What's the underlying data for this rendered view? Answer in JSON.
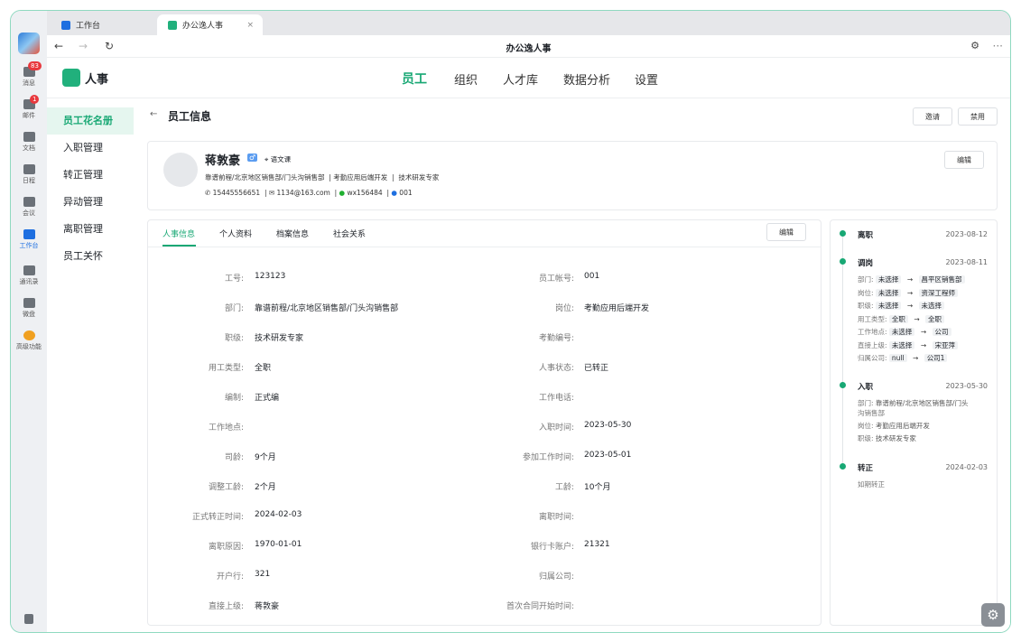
{
  "rail": {
    "badge_messages": "83",
    "badge_mail": "1",
    "items": [
      "消息",
      "邮件",
      "文档",
      "日程",
      "会议",
      "工作台",
      "通讯录",
      "微盘",
      "高级功能"
    ]
  },
  "tabs": [
    "工作台",
    "办公逸人事"
  ],
  "address_title": "办公逸人事",
  "brand": "人事",
  "topnav": [
    "员工",
    "组织",
    "人才库",
    "数据分析",
    "设置"
  ],
  "sidebar": [
    "员工花名册",
    "入职管理",
    "转正管理",
    "异动管理",
    "离职管理",
    "员工关怀"
  ],
  "page_title": "员工信息",
  "buttons": {
    "invite": "邀请",
    "disable": "禁用",
    "edit": "编辑"
  },
  "profile": {
    "name": "蒋敦豪",
    "gender": "♂",
    "tag": "语文课",
    "dept_line": "靠谱前程/北京地区销售部/门头沟销售部",
    "post": "考勤应用后端开发",
    "level": "技术研发专家",
    "phone": "15445556651",
    "email": "1134@163.com",
    "wechat": "wx156484",
    "im": "001"
  },
  "info_tabs": [
    "人事信息",
    "个人资料",
    "档案信息",
    "社会关系"
  ],
  "fields_left": [
    [
      "工号:",
      "123123"
    ],
    [
      "部门:",
      "靠谱前程/北京地区销售部/门头沟销售部"
    ],
    [
      "职级:",
      "技术研发专家"
    ],
    [
      "用工类型:",
      "全职"
    ],
    [
      "编制:",
      "正式编"
    ],
    [
      "工作地点:",
      ""
    ],
    [
      "司龄:",
      "9个月"
    ],
    [
      "调整工龄:",
      "2个月"
    ],
    [
      "正式转正时间:",
      "2024-02-03"
    ],
    [
      "离职原因:",
      "1970-01-01"
    ],
    [
      "开户行:",
      "321"
    ],
    [
      "直接上级:",
      "蒋敦豪"
    ]
  ],
  "fields_right": [
    [
      "员工帐号:",
      "001"
    ],
    [
      "岗位:",
      "考勤应用后端开发"
    ],
    [
      "考勤编号:",
      ""
    ],
    [
      "人事状态:",
      "已转正"
    ],
    [
      "工作电话:",
      ""
    ],
    [
      "入职时间:",
      "2023-05-30"
    ],
    [
      "参加工作时间:",
      "2023-05-01"
    ],
    [
      "工龄:",
      "10个月"
    ],
    [
      "离职时间:",
      ""
    ],
    [
      "银行卡账户:",
      "21321"
    ],
    [
      "归属公司:",
      ""
    ],
    [
      "首次合同开始时间:",
      ""
    ]
  ],
  "timeline": {
    "t1": {
      "title": "离职",
      "date": "2023-08-12"
    },
    "t2": {
      "title": "调岗",
      "date": "2023-08-11",
      "rows": [
        [
          "部门:",
          "未选择",
          "昌平区销售部"
        ],
        [
          "岗位:",
          "未选择",
          "资深工程师"
        ],
        [
          "职级:",
          "未选择",
          "未选择"
        ],
        [
          "用工类型:",
          "全职",
          "全职"
        ],
        [
          "工作地点:",
          "未选择",
          "公司"
        ],
        [
          "直接上级:",
          "未选择",
          "宋亚萍"
        ],
        [
          "归属公司:",
          "null",
          "公司1"
        ]
      ]
    },
    "t3": {
      "title": "入职",
      "date": "2023-05-30",
      "dept": "部门:",
      "dept_v": "靠谱前程/北京地区销售部/门头",
      "dept_v2": "沟销售部",
      "post": "岗位:",
      "post_v": "考勤应用后端开发",
      "lvl": "职级:",
      "lvl_v": "技术研发专家"
    },
    "t4": {
      "title": "转正",
      "date": "2024-02-03",
      "note": "如期转正"
    }
  },
  "arrow": "→",
  "colors": {
    "accent": "#18a874"
  }
}
